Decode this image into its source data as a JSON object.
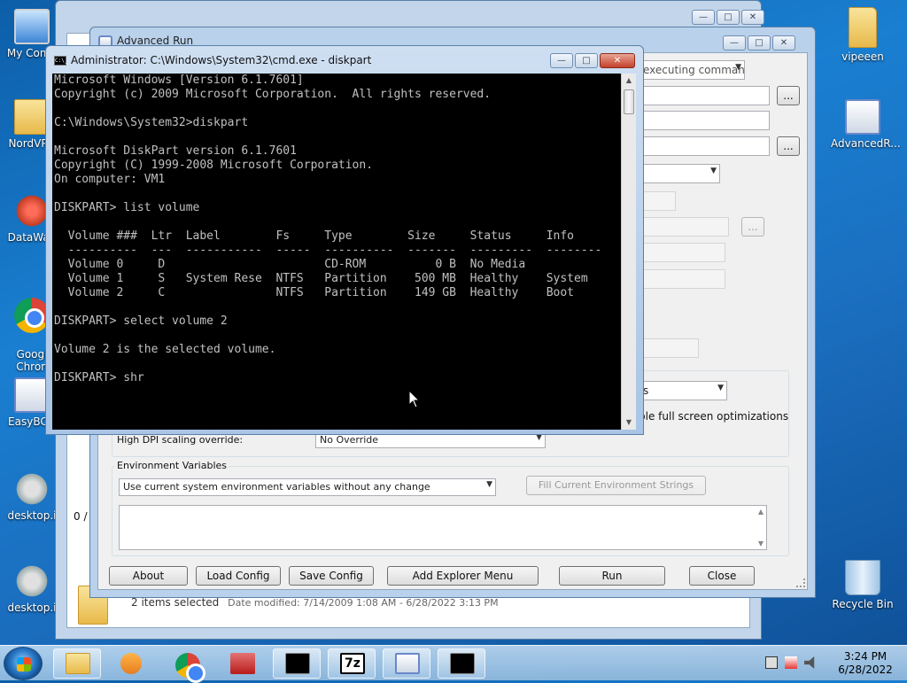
{
  "desktop": {
    "icons_left": [
      {
        "label": "My Comp",
        "icon": "monitor"
      },
      {
        "label": "NordVPN",
        "icon": "folder"
      },
      {
        "label": "DataWag",
        "icon": "gear"
      },
      {
        "label": "Googl\nChron",
        "icon": "chrome"
      },
      {
        "label": "EasyBCD",
        "icon": "app"
      },
      {
        "label": "desktop.i",
        "icon": "gear"
      },
      {
        "label": "desktop.i",
        "icon": "gear"
      }
    ],
    "icons_right": [
      {
        "label": "vipeeen",
        "icon": "folder"
      },
      {
        "label": "AdvancedR...",
        "icon": "app"
      },
      {
        "label": "Recycle Bin",
        "icon": "bin"
      }
    ]
  },
  "explorer": {
    "status_selected": "2 items selected",
    "status_modified": "Date modified: 7/14/2009 1:08 AM - 6/28/2022 3:13 PM",
    "left_text": "0 /"
  },
  "advanced_run": {
    "title": "Advanced Run",
    "run_mode": "executing comman",
    "high_dpi_label": "High DPI scaling override:",
    "high_dpi_value": "No Override",
    "fullscreen_opt": "ble full screen optimizations",
    "env_group_label": "Environment Variables",
    "env_mode": "Use current system environment variables without any change",
    "fill_env_button": "Fill Current Environment Strings",
    "ellipsis": "...",
    "combo_partial": "s",
    "buttons": {
      "about": "About",
      "load_config": "Load Config",
      "save_config": "Save Config",
      "add_explorer_menu": "Add Explorer Menu",
      "run": "Run",
      "close": "Close"
    }
  },
  "cmd": {
    "title": "Administrator: C:\\Windows\\System32\\cmd.exe - diskpart",
    "icon_text": "C:\\_",
    "output": "Microsoft Windows [Version 6.1.7601]\nCopyright (c) 2009 Microsoft Corporation.  All rights reserved.\n\nC:\\Windows\\System32>diskpart\n\nMicrosoft DiskPart version 6.1.7601\nCopyright (C) 1999-2008 Microsoft Corporation.\nOn computer: VM1\n\nDISKPART> list volume\n\n  Volume ###  Ltr  Label        Fs     Type        Size     Status     Info\n  ----------  ---  -----------  -----  ----------  -------  ---------  --------\n  Volume 0     D                       CD-ROM          0 B  No Media\n  Volume 1     S   System Rese  NTFS   Partition    500 MB  Healthy    System\n  Volume 2     C                NTFS   Partition    149 GB  Healthy    Boot\n\nDISKPART> select volume 2\n\nVolume 2 is the selected volume.\n\nDISKPART> shr"
  },
  "taskbar": {
    "clock_time": "3:24 PM",
    "clock_date": "6/28/2022",
    "tray_icons": [
      "network-icon",
      "flag-icon",
      "speaker-icon"
    ]
  },
  "colors": {
    "console_bg": "#000000",
    "console_fg": "#c0c0c0",
    "desktop_blue": "#1a7fd1"
  }
}
